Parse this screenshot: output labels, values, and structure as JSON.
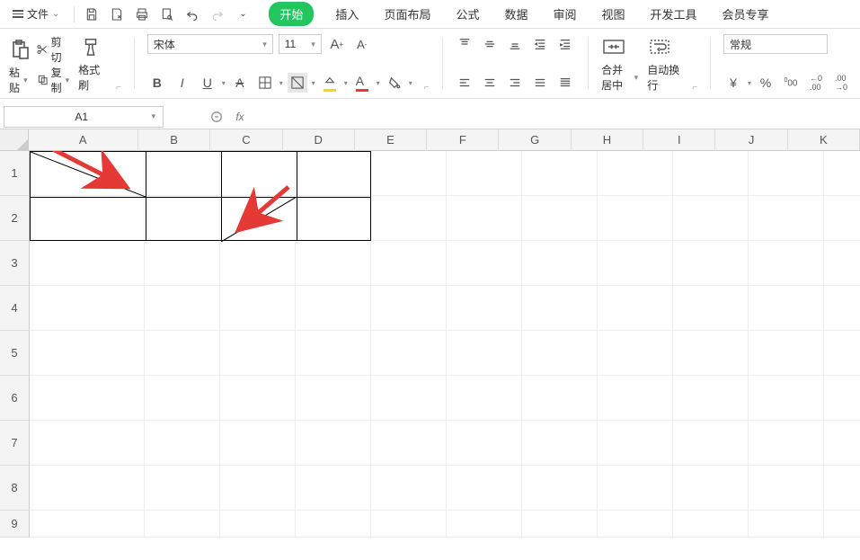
{
  "topbar": {
    "file_label": "文件",
    "tabs": [
      "开始",
      "插入",
      "页面布局",
      "公式",
      "数据",
      "审阅",
      "视图",
      "开发工具",
      "会员专享"
    ],
    "active_tab_index": 0
  },
  "ribbon": {
    "paste": "粘贴",
    "cut": "剪切",
    "copy": "复制",
    "format_painter": "格式刷",
    "font_name": "宋体",
    "font_size": "11",
    "merge_center": "合并居中",
    "wrap_text": "自动换行",
    "number_format": "常规",
    "currency": "¥",
    "percent": "%",
    "comma": "000",
    "inc_dec_1": ".00",
    "inc_dec_2": ".00"
  },
  "formula_bar": {
    "cell_ref": "A1",
    "fx_label": "fx",
    "formula": ""
  },
  "grid": {
    "columns": [
      "A",
      "B",
      "C",
      "D",
      "E",
      "F",
      "G",
      "H",
      "I",
      "J",
      "K"
    ],
    "rows": [
      "1",
      "2",
      "3",
      "4",
      "5",
      "6",
      "7",
      "8",
      "9"
    ]
  }
}
